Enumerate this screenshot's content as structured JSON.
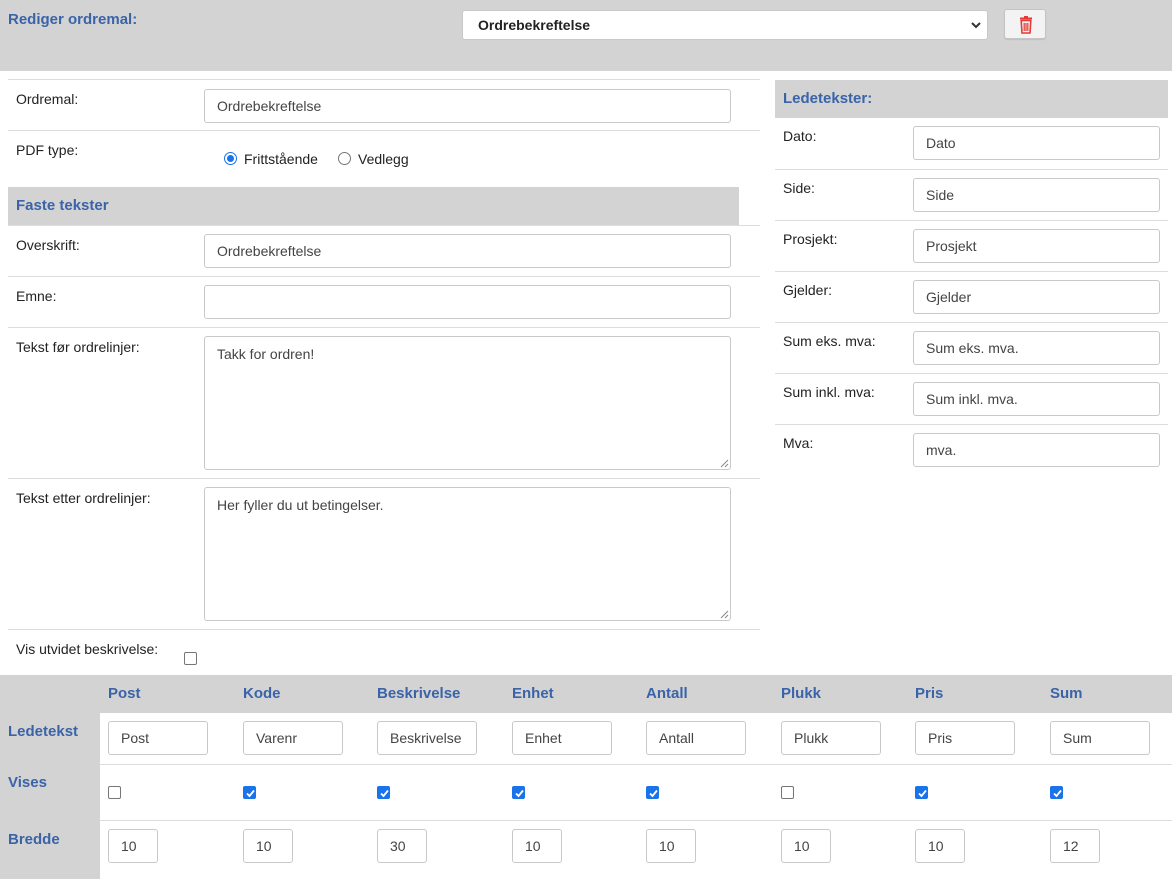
{
  "header": {
    "title": "Rediger ordremal:",
    "selected_template": "Ordrebekreftelse",
    "template_options": [
      "Ordrebekreftelse"
    ],
    "delete_icon": "trash-icon",
    "delete_icon_color": "#e53935"
  },
  "form": {
    "ordremal_label": "Ordremal:",
    "ordremal_value": "Ordrebekreftelse",
    "pdf_type_label": "PDF type:",
    "pdf_options": [
      {
        "label": "Frittstående",
        "checked": true
      },
      {
        "label": "Vedlegg",
        "checked": false
      }
    ],
    "faste_tekster_heading": "Faste tekster",
    "overskrift_label": "Overskrift:",
    "overskrift_value": "Ordrebekreftelse",
    "emne_label": "Emne:",
    "emne_value": "",
    "tekst_for_label": "Tekst før ordrelinjer:",
    "tekst_for_value": "Takk for ordren!",
    "tekst_etter_label": "Tekst etter ordrelinjer:",
    "tekst_etter_value": "Her fyller du ut betingelser.",
    "vis_utvidet_label": "Vis utvidet beskrivelse:",
    "vis_utvidet_checked": false
  },
  "ledetekster": {
    "heading": "Ledetekster:",
    "items": [
      {
        "label": "Dato:",
        "value": "Dato"
      },
      {
        "label": "Side:",
        "value": "Side"
      },
      {
        "label": "Prosjekt:",
        "value": "Prosjekt"
      },
      {
        "label": "Gjelder:",
        "value": "Gjelder"
      },
      {
        "label": "Sum eks. mva:",
        "value": "Sum eks. mva."
      },
      {
        "label": "Sum inkl. mva:",
        "value": "Sum inkl. mva."
      },
      {
        "label": "Mva:",
        "value": "mva."
      }
    ]
  },
  "columns_table": {
    "row_labels": {
      "ledetekst": "Ledetekst",
      "vises": "Vises",
      "bredde": "Bredde"
    },
    "columns": [
      {
        "header": "Post",
        "ledetekst": "Post",
        "vises": false,
        "bredde": "10"
      },
      {
        "header": "Kode",
        "ledetekst": "Varenr",
        "vises": true,
        "bredde": "10"
      },
      {
        "header": "Beskrivelse",
        "ledetekst": "Beskrivelse",
        "vises": true,
        "bredde": "30"
      },
      {
        "header": "Enhet",
        "ledetekst": "Enhet",
        "vises": true,
        "bredde": "10"
      },
      {
        "header": "Antall",
        "ledetekst": "Antall",
        "vises": true,
        "bredde": "10"
      },
      {
        "header": "Plukk",
        "ledetekst": "Plukk",
        "vises": false,
        "bredde": "10"
      },
      {
        "header": "Pris",
        "ledetekst": "Pris",
        "vises": true,
        "bredde": "10"
      },
      {
        "header": "Sum",
        "ledetekst": "Sum",
        "vises": true,
        "bredde": "12"
      }
    ]
  },
  "colors": {
    "accent": "#3a63a8",
    "header_bg": "#d3d3d3",
    "checkbox_on": "#1a73e8"
  }
}
